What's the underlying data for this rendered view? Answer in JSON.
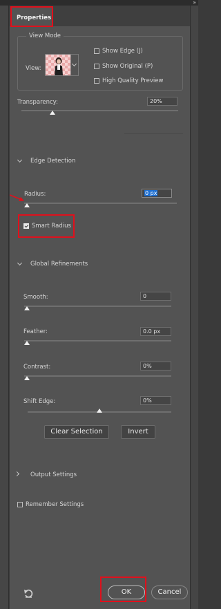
{
  "panel": {
    "tab_title": "Properties",
    "collapse_icon": "double-chevron-right"
  },
  "view_mode": {
    "legend": "View Mode",
    "view_label": "View:",
    "show_edge": "Show Edge (J)",
    "show_original": "Show Original (P)",
    "high_quality_preview": "High Quality Preview"
  },
  "transparency": {
    "label": "Transparency:",
    "value": "20%",
    "level": 0.2
  },
  "edge_detection": {
    "title": "Edge Detection",
    "radius_label": "Radius:",
    "radius_value": "0 px",
    "radius_level": 0,
    "smart_radius_label": "Smart Radius",
    "smart_radius_checked": true
  },
  "global_refinements": {
    "title": "Global Refinements",
    "smooth": {
      "label": "Smooth:",
      "value": "0",
      "level": 0
    },
    "feather": {
      "label": "Feather:",
      "value": "0.0 px",
      "level": 0
    },
    "contrast": {
      "label": "Contrast:",
      "value": "0%",
      "level": 0
    },
    "shift_edge": {
      "label": "Shift Edge:",
      "value": "0%",
      "level": 0.5
    },
    "clear_selection": "Clear Selection",
    "invert": "Invert"
  },
  "output_settings": {
    "title": "Output Settings"
  },
  "remember_settings": "Remember Settings",
  "footer": {
    "ok": "OK",
    "cancel": "Cancel",
    "reset_icon": "reset-icon"
  },
  "colors": {
    "panel": "#535353",
    "highlight": "#e0101c",
    "field_selected": "#1e6fd0"
  }
}
